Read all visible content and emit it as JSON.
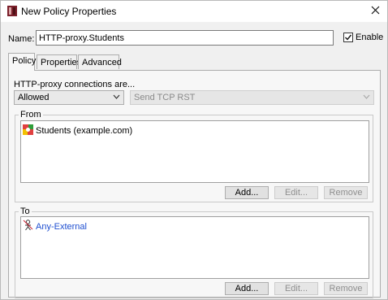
{
  "window": {
    "title": "New Policy Properties"
  },
  "name_field": {
    "label": "Name:",
    "value": "HTTP-proxy.Students"
  },
  "enable": {
    "label": "Enable",
    "checked": true
  },
  "tabs": [
    {
      "label": "Policy",
      "active": true
    },
    {
      "label": "Properties",
      "active": false
    },
    {
      "label": "Advanced",
      "active": false
    }
  ],
  "policy": {
    "connections_label": "HTTP-proxy connections are...",
    "action_select": {
      "value": "Allowed"
    },
    "tcp_select": {
      "value": "Send TCP RST"
    },
    "from": {
      "title": "From",
      "items": [
        {
          "label": "Students (example.com)",
          "icon": "user-group-icon"
        }
      ],
      "buttons": {
        "add": "Add...",
        "edit": "Edit...",
        "remove": "Remove"
      }
    },
    "to": {
      "title": "To",
      "items": [
        {
          "label": "Any-External",
          "icon": "any-external-icon",
          "color": "#1f4fd0"
        }
      ],
      "buttons": {
        "add": "Add...",
        "edit": "Edit...",
        "remove": "Remove"
      }
    }
  }
}
